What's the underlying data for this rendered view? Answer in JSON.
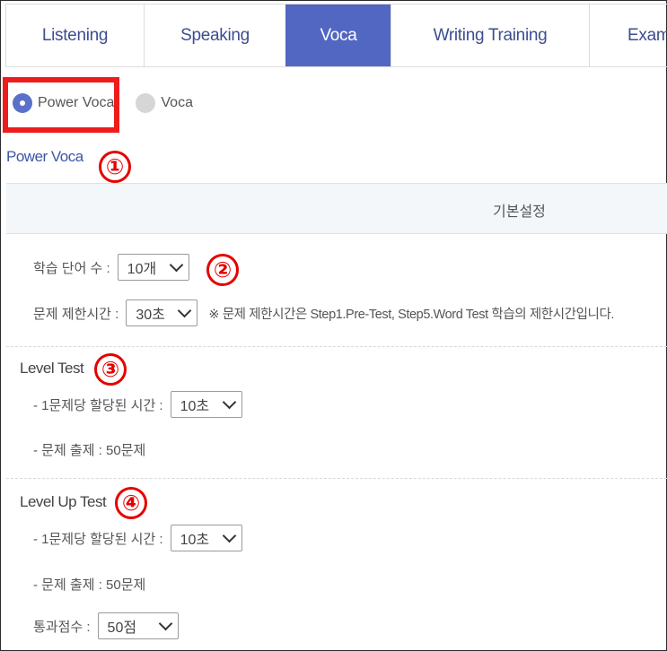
{
  "tabs": [
    {
      "label": "Listening",
      "active": false
    },
    {
      "label": "Speaking",
      "active": false
    },
    {
      "label": "Voca",
      "active": true
    },
    {
      "label": "Writing Training",
      "active": false
    },
    {
      "label": "Exam",
      "active": false
    }
  ],
  "radio": {
    "option1": "Power Voca",
    "option2": "Voca",
    "selected": "Power Voca"
  },
  "section_title": "Power Voca",
  "basic_settings_header": "기본설정",
  "settings": {
    "word_count_label": "학습 단어 수 :",
    "word_count_value": "10개",
    "time_limit_label": "문제 제한시간 :",
    "time_limit_value": "30초",
    "time_limit_note": "※ 문제 제한시간은 Step1.Pre-Test, Step5.Word Test 학습의 제한시간입니다."
  },
  "level_test": {
    "title": "Level Test",
    "time_label": "- 1문제당 할당된 시간 :",
    "time_value": "10초",
    "questions_text": "- 문제 출제 : 50문제"
  },
  "level_up_test": {
    "title": "Level Up Test",
    "time_label": "- 1문제당 할당된 시간 :",
    "time_value": "10초",
    "questions_text": "- 문제 출제 : 50문제",
    "pass_label": "통과점수 :",
    "pass_value": "50점"
  },
  "markers": [
    "①",
    "②",
    "③",
    "④"
  ],
  "colors": {
    "accent": "#5267c2",
    "marker": "#e60000",
    "title": "#3d56a8"
  }
}
